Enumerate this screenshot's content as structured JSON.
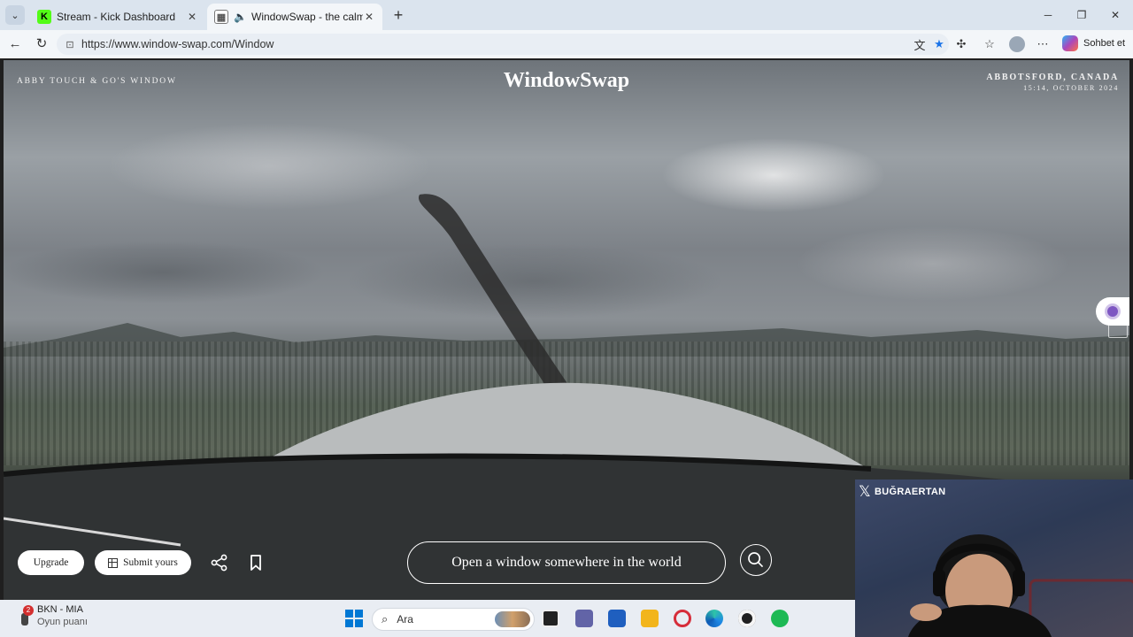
{
  "browser": {
    "tabs": [
      {
        "label": "Stream - Kick Dashboard",
        "favicon": "K",
        "active": false
      },
      {
        "label": "WindowSwap - the calmest p",
        "favicon": "WS",
        "active": true
      }
    ],
    "url": "https://www.window-swap.com/Window",
    "copilot_label": "Sohbet et"
  },
  "windowswap": {
    "owner": "Abby Touch & Go's Window",
    "brand": "WindowSwap",
    "location": "Abbotsford, Canada",
    "datetime": "15:14, October 2024",
    "upgrade_label": "Upgrade",
    "submit_label": "Submit yours",
    "search_label": "Open a window somewhere in the world"
  },
  "webcam": {
    "handle": "BUĞRAERTAN"
  },
  "taskbar": {
    "weather_badge": "2",
    "weather_title": "BKN - MIA",
    "weather_subtitle": "Oyun puanı",
    "search_placeholder": "Ara"
  },
  "colors": {
    "accent": "#1a73e8",
    "tab_bar": "#dbe4ee",
    "kick_green": "#53fc18"
  }
}
